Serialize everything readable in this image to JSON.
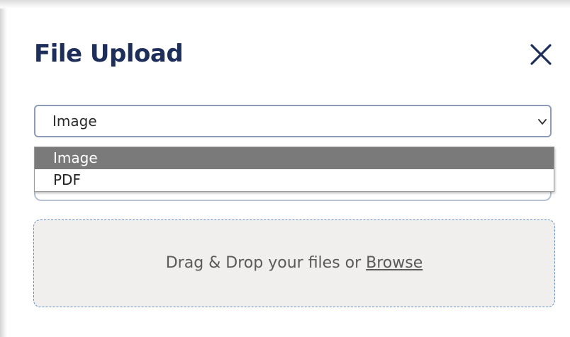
{
  "dialog": {
    "title": "File Upload",
    "close_icon": "close-icon"
  },
  "file_type_select": {
    "value": "Image",
    "chevron_icon": "chevron-down-icon",
    "options": [
      {
        "label": "Image",
        "selected": true
      },
      {
        "label": "PDF",
        "selected": false
      }
    ]
  },
  "dropzone": {
    "text": "Drag & Drop your files or ",
    "browse_label": "Browse"
  },
  "colors": {
    "title": "#1d2e5a",
    "select_border": "#8e9bb8",
    "option_highlight": "#7a7a7a",
    "dropzone_bg": "#f1efed",
    "dropzone_border": "#5f8fc4"
  }
}
